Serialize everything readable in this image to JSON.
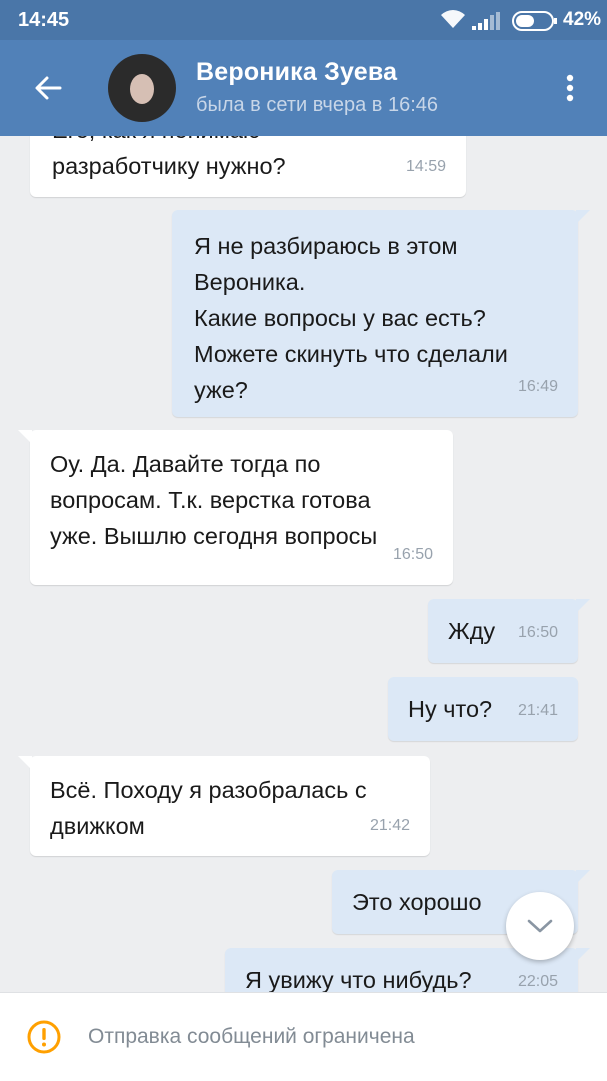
{
  "statusbar": {
    "time": "14:45",
    "battery": "42%"
  },
  "header": {
    "contact_name": "Вероника Зуева",
    "last_seen": "была в сети вчера в 16:46",
    "back_icon": "arrow-left-icon",
    "menu_icon": "more-vert-icon"
  },
  "messages": [
    {
      "direction": "in",
      "text": "Его, как я понимаю\nразработчику нужно?",
      "time": "14:59"
    },
    {
      "direction": "out",
      "text": "Я не разбираюсь в этом\nВероника.\nКакие вопросы у вас есть?\nМожете скинуть что сделали\nуже?",
      "time": "16:49"
    },
    {
      "direction": "in",
      "text": "Оу. Да. Давайте тогда по\nвопросам. Т.к. верстка готова\nуже. Вышлю сегодня вопросы",
      "time": "16:50"
    },
    {
      "direction": "out",
      "text": "Жду",
      "time": "16:50"
    },
    {
      "direction": "out",
      "text": "Ну что?",
      "time": "21:41"
    },
    {
      "direction": "in",
      "text": "Всё. Походу я разобралась с\nдвижком",
      "time": "21:42"
    },
    {
      "direction": "out",
      "text": "Это хорошо",
      "time": ""
    },
    {
      "direction": "out",
      "text": "Я увижу что нибудь?",
      "time": "22:05"
    }
  ],
  "footer": {
    "notice": "Отправка сообщений ограничена",
    "icon": "warning-circle-icon"
  },
  "colors": {
    "statusbar": "#4a76a8",
    "header": "#5181b8",
    "incoming": "#ffffff",
    "outgoing": "#dce8f6",
    "warning": "#ffa000"
  }
}
